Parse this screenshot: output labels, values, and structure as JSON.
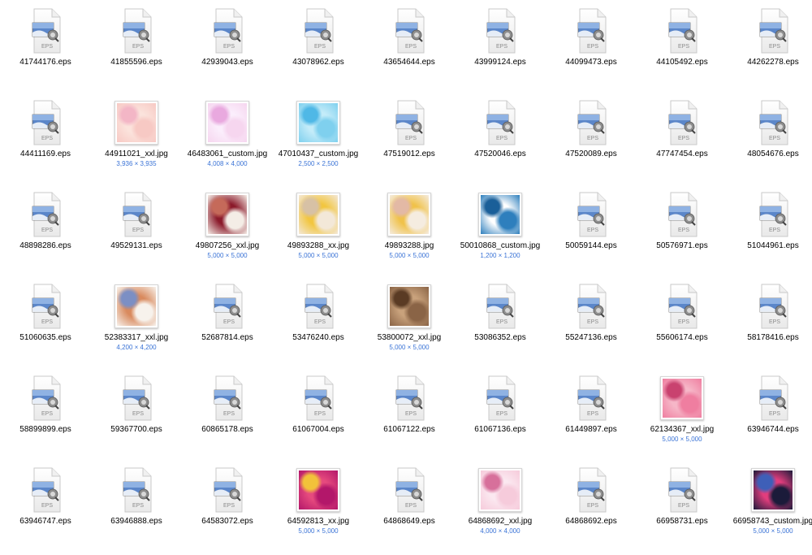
{
  "icons": {
    "eps": "eps-document-icon",
    "image": "image-thumbnail"
  },
  "eps_badge": "EPS",
  "files": [
    {
      "name": "41744176.eps",
      "type": "eps"
    },
    {
      "name": "41855596.eps",
      "type": "eps"
    },
    {
      "name": "42939043.eps",
      "type": "eps"
    },
    {
      "name": "43078962.eps",
      "type": "eps"
    },
    {
      "name": "43654644.eps",
      "type": "eps"
    },
    {
      "name": "43999124.eps",
      "type": "eps"
    },
    {
      "name": "44099473.eps",
      "type": "eps"
    },
    {
      "name": "44105492.eps",
      "type": "eps"
    },
    {
      "name": "44262278.eps",
      "type": "eps"
    },
    {
      "name": "44411169.eps",
      "type": "eps"
    },
    {
      "name": "44911021_xxl.jpg",
      "type": "jpg",
      "dims": "3,936 × 3,935",
      "colors": [
        "#f7c9c4",
        "#fbe3dc",
        "#f3b6c6"
      ]
    },
    {
      "name": "46483061_custom.jpg",
      "type": "jpg",
      "dims": "4,008 × 4,000",
      "colors": [
        "#f6d6ef",
        "#fbeefc",
        "#e9a9df"
      ]
    },
    {
      "name": "47010437_custom.jpg",
      "type": "jpg",
      "dims": "2,500 × 2,500",
      "colors": [
        "#7fd0ee",
        "#c4ecf9",
        "#4fb8e6"
      ]
    },
    {
      "name": "47519012.eps",
      "type": "eps"
    },
    {
      "name": "47520046.eps",
      "type": "eps"
    },
    {
      "name": "47520089.eps",
      "type": "eps"
    },
    {
      "name": "47747454.eps",
      "type": "eps"
    },
    {
      "name": "48054676.eps",
      "type": "eps"
    },
    {
      "name": "48898286.eps",
      "type": "eps"
    },
    {
      "name": "49529131.eps",
      "type": "eps"
    },
    {
      "name": "49807256_xxl.jpg",
      "type": "jpg",
      "dims": "5,000 × 5,000",
      "colors": [
        "#f4ede6",
        "#8b1a2b",
        "#c56a5a"
      ]
    },
    {
      "name": "49893288_xx.jpg",
      "type": "jpg",
      "dims": "5,000 × 5,000",
      "colors": [
        "#f3e8d8",
        "#f2c640",
        "#d7c1a5"
      ]
    },
    {
      "name": "49893288.jpg",
      "type": "jpg",
      "dims": "5,000 × 5,000",
      "colors": [
        "#f5ece0",
        "#f0c24a",
        "#e3b9a5"
      ]
    },
    {
      "name": "50010868_custom.jpg",
      "type": "jpg",
      "dims": "1,200 × 1,200",
      "colors": [
        "#2e7fbd",
        "#ffffff",
        "#1a5f99"
      ]
    },
    {
      "name": "50059144.eps",
      "type": "eps"
    },
    {
      "name": "50576971.eps",
      "type": "eps"
    },
    {
      "name": "51044961.eps",
      "type": "eps"
    },
    {
      "name": "51060635.eps",
      "type": "eps"
    },
    {
      "name": "52383317_xxl.jpg",
      "type": "jpg",
      "dims": "4,200 × 4,200",
      "colors": [
        "#f7f2ec",
        "#d98a5e",
        "#7c8fc4"
      ]
    },
    {
      "name": "52687814.eps",
      "type": "eps"
    },
    {
      "name": "53476240.eps",
      "type": "eps"
    },
    {
      "name": "53800072_xxl.jpg",
      "type": "jpg",
      "dims": "5,000 × 5,000",
      "colors": [
        "#8a6446",
        "#c9a27c",
        "#5a3b24"
      ]
    },
    {
      "name": "53086352.eps",
      "type": "eps"
    },
    {
      "name": "55247136.eps",
      "type": "eps"
    },
    {
      "name": "55606174.eps",
      "type": "eps"
    },
    {
      "name": "58178416.eps",
      "type": "eps"
    },
    {
      "name": "58899899.eps",
      "type": "eps"
    },
    {
      "name": "59367700.eps",
      "type": "eps"
    },
    {
      "name": "60865178.eps",
      "type": "eps"
    },
    {
      "name": "61067004.eps",
      "type": "eps"
    },
    {
      "name": "61067122.eps",
      "type": "eps"
    },
    {
      "name": "61067136.eps",
      "type": "eps"
    },
    {
      "name": "61449897.eps",
      "type": "eps"
    },
    {
      "name": "62134367_xxl.jpg",
      "type": "jpg",
      "dims": "5,000 × 5,000",
      "colors": [
        "#ef7ea0",
        "#f6b7c8",
        "#c9426f"
      ]
    },
    {
      "name": "63946744.eps",
      "type": "eps"
    },
    {
      "name": "63946747.eps",
      "type": "eps"
    },
    {
      "name": "63946888.eps",
      "type": "eps"
    },
    {
      "name": "64583072.eps",
      "type": "eps"
    },
    {
      "name": "64592813_xx.jpg",
      "type": "jpg",
      "dims": "5,000 × 5,000",
      "colors": [
        "#b3176a",
        "#e64a7e",
        "#f2c23a"
      ]
    },
    {
      "name": "64868649.eps",
      "type": "eps"
    },
    {
      "name": "64868692_xxl.jpg",
      "type": "jpg",
      "dims": "4,000 × 4,000",
      "colors": [
        "#f6cbdb",
        "#fbe8f0",
        "#d7709b"
      ]
    },
    {
      "name": "64868692.eps",
      "type": "eps"
    },
    {
      "name": "66958731.eps",
      "type": "eps"
    },
    {
      "name": "66958743_custom.jpg",
      "type": "jpg",
      "dims": "5,000 × 5,000",
      "colors": [
        "#1b1b3a",
        "#e23d7d",
        "#3e5fb8"
      ]
    }
  ]
}
